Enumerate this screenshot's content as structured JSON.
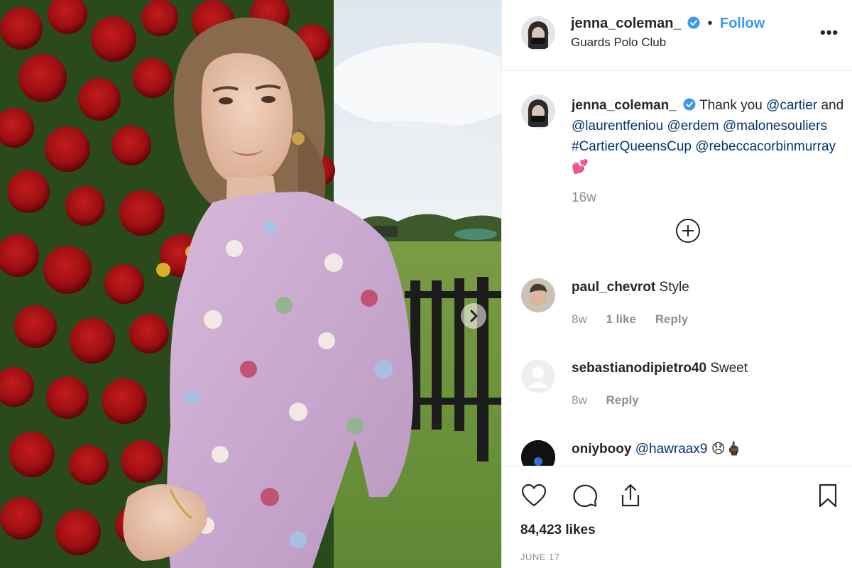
{
  "post": {
    "next_icon": "chevron-right-icon",
    "author": {
      "username": "jenna_coleman_",
      "verified": true,
      "location": "Guards Polo Club",
      "follow_label": "Follow",
      "separator": "•",
      "more_label": "•••"
    },
    "caption": {
      "username": "jenna_coleman_",
      "text_1": "Thank you",
      "mentions": [
        "@cartier",
        "@laurentfeniou",
        "@erdem",
        "@malonesouliers",
        "#CartierQueensCup",
        "@rebeccacorbinmurray"
      ],
      "and_word": "and",
      "emoji": "💕",
      "time": "16w",
      "load_more_icon": "plus-circle-icon"
    },
    "comments": [
      {
        "username": "paul_chevrot",
        "text": "Style",
        "time": "8w",
        "likes": "1 like",
        "reply": "Reply"
      },
      {
        "username": "sebastianodipietro40",
        "text": "Sweet",
        "time": "8w",
        "reply": "Reply"
      },
      {
        "username": "oniybooy",
        "mention": "@hawraax9",
        "emoji": "😞🖕🏿"
      }
    ],
    "actions": {
      "like_icon": "heart-icon",
      "comment_icon": "comment-icon",
      "share_icon": "share-icon",
      "save_icon": "bookmark-icon"
    },
    "likes": "84,423 likes",
    "date": "JUNE 17"
  },
  "colors": {
    "link": "#003569",
    "follow": "#3897f0",
    "muted": "#8e8e8e",
    "verified": "#3897f0",
    "text": "#262626"
  }
}
